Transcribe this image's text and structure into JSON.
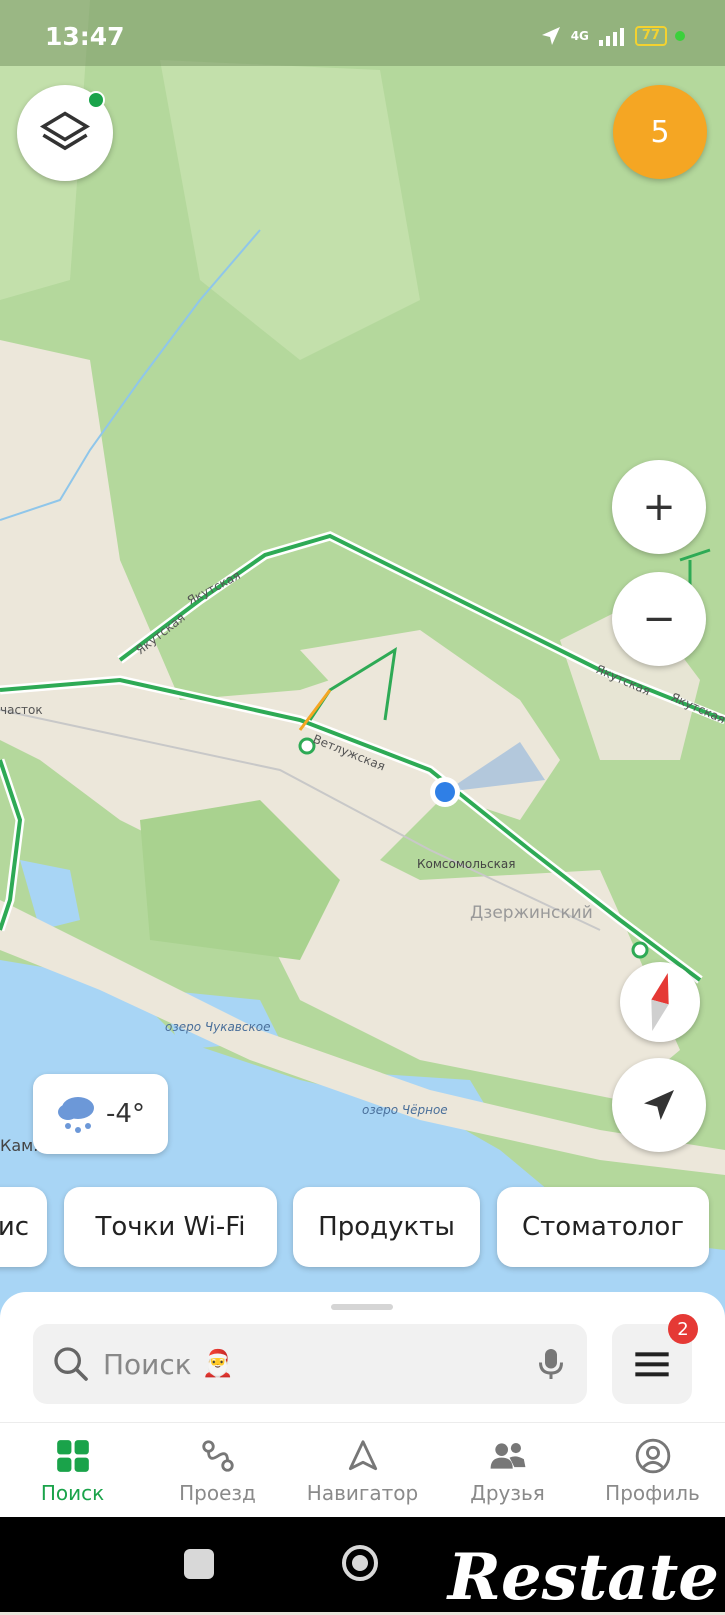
{
  "status_bar": {
    "time": "13:47",
    "network": "4G",
    "battery": "77"
  },
  "map": {
    "labels": {
      "street_1": "Якутская",
      "street_2": "Якутская",
      "street_3": "Якутская",
      "street_4": "Якутская",
      "uchastok": "часток",
      "vetluzhskaya": "Ветлужская",
      "komsomolskaya": "Комсомольская",
      "dzerzhinsky": "Дзержинский",
      "lake_chukavskoe": "озеро Чукавское",
      "lake_chernoe": "озеро Чёрное",
      "kam": "Кам."
    },
    "colors": {
      "forest": "#b4d89c",
      "urban": "#ece7da",
      "water": "#a8d5f5",
      "road": "#2eaa55"
    }
  },
  "layers_button": {
    "icon": "layers-icon"
  },
  "notifications_badge": {
    "count": "5"
  },
  "zoom": {
    "plus": "+",
    "minus": "−"
  },
  "weather": {
    "temperature": "-4°",
    "icon": "snow-cloud-icon"
  },
  "chips": [
    {
      "label": "ис"
    },
    {
      "label": "Точки Wi-Fi"
    },
    {
      "label": "Продукты"
    },
    {
      "label": "Стоматолог"
    }
  ],
  "search": {
    "placeholder": "Поиск",
    "emoji": "🎅"
  },
  "menu": {
    "badge": "2"
  },
  "tabs": [
    {
      "label": "Поиск",
      "icon": "search-grid-icon",
      "active": true
    },
    {
      "label": "Проезд",
      "icon": "route-icon",
      "active": false
    },
    {
      "label": "Навигатор",
      "icon": "navigator-icon",
      "active": false
    },
    {
      "label": "Друзья",
      "icon": "friends-icon",
      "active": false
    },
    {
      "label": "Профиль",
      "icon": "profile-icon",
      "active": false
    }
  ],
  "watermark": "Restate"
}
